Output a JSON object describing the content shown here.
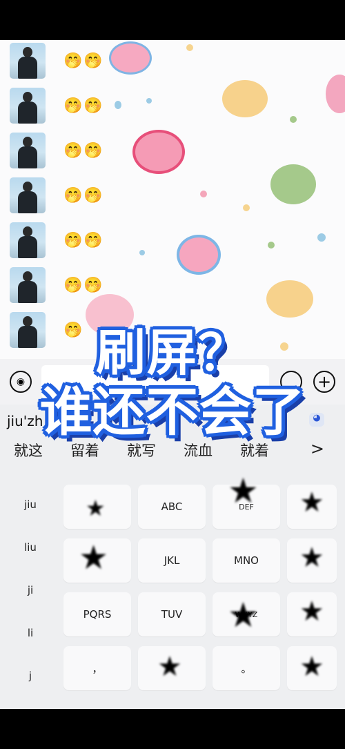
{
  "chat": {
    "messages": [
      {
        "emoji": "🤭🤭"
      },
      {
        "emoji": "🤭🤭"
      },
      {
        "emoji": "🤭🤭"
      },
      {
        "emoji": "🤭🤭"
      },
      {
        "emoji": "🤭🤭"
      },
      {
        "emoji": "🤭🤭"
      },
      {
        "emoji": "🤭"
      }
    ]
  },
  "overlay": {
    "line1": "刷屏？",
    "line2": "谁还不会了"
  },
  "input_bar": {
    "voice_icon": "voice-icon",
    "plus_label": "+"
  },
  "keyboard": {
    "composing": "jiu'zh",
    "candidates": [
      "就这",
      "留着",
      "就写",
      "流血",
      "就着"
    ],
    "more_label": ">",
    "syllables": [
      "jiu",
      "liu",
      "ji",
      "li",
      "j"
    ],
    "keys": {
      "abc": "ABC",
      "def": "DEF",
      "jkl": "JKL",
      "mno": "MNO",
      "pqrs": "PQRS",
      "tuv": "TUV",
      "wxyz": "WXYZ",
      "comma": "，",
      "period": "。"
    }
  }
}
